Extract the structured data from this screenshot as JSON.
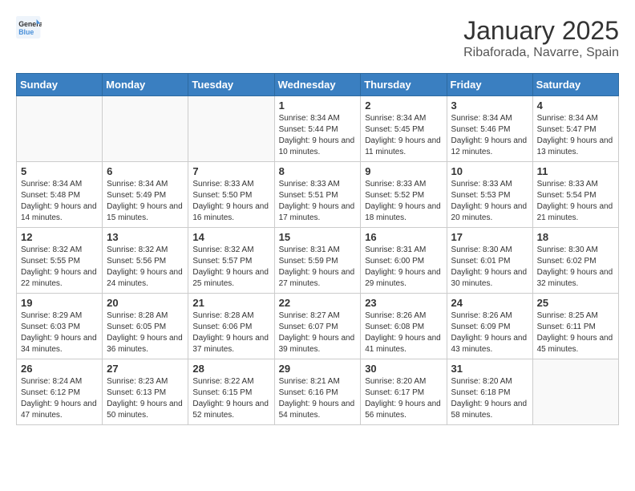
{
  "header": {
    "logo_general": "General",
    "logo_blue": "Blue",
    "title": "January 2025",
    "subtitle": "Ribaforada, Navarre, Spain"
  },
  "weekdays": [
    "Sunday",
    "Monday",
    "Tuesday",
    "Wednesday",
    "Thursday",
    "Friday",
    "Saturday"
  ],
  "weeks": [
    [
      {
        "date": "",
        "sunrise": "",
        "sunset": "",
        "daylight": "",
        "empty": true
      },
      {
        "date": "",
        "sunrise": "",
        "sunset": "",
        "daylight": "",
        "empty": true
      },
      {
        "date": "",
        "sunrise": "",
        "sunset": "",
        "daylight": "",
        "empty": true
      },
      {
        "date": "1",
        "sunrise": "Sunrise: 8:34 AM",
        "sunset": "Sunset: 5:44 PM",
        "daylight": "Daylight: 9 hours and 10 minutes.",
        "empty": false
      },
      {
        "date": "2",
        "sunrise": "Sunrise: 8:34 AM",
        "sunset": "Sunset: 5:45 PM",
        "daylight": "Daylight: 9 hours and 11 minutes.",
        "empty": false
      },
      {
        "date": "3",
        "sunrise": "Sunrise: 8:34 AM",
        "sunset": "Sunset: 5:46 PM",
        "daylight": "Daylight: 9 hours and 12 minutes.",
        "empty": false
      },
      {
        "date": "4",
        "sunrise": "Sunrise: 8:34 AM",
        "sunset": "Sunset: 5:47 PM",
        "daylight": "Daylight: 9 hours and 13 minutes.",
        "empty": false
      }
    ],
    [
      {
        "date": "5",
        "sunrise": "Sunrise: 8:34 AM",
        "sunset": "Sunset: 5:48 PM",
        "daylight": "Daylight: 9 hours and 14 minutes.",
        "empty": false
      },
      {
        "date": "6",
        "sunrise": "Sunrise: 8:34 AM",
        "sunset": "Sunset: 5:49 PM",
        "daylight": "Daylight: 9 hours and 15 minutes.",
        "empty": false
      },
      {
        "date": "7",
        "sunrise": "Sunrise: 8:33 AM",
        "sunset": "Sunset: 5:50 PM",
        "daylight": "Daylight: 9 hours and 16 minutes.",
        "empty": false
      },
      {
        "date": "8",
        "sunrise": "Sunrise: 8:33 AM",
        "sunset": "Sunset: 5:51 PM",
        "daylight": "Daylight: 9 hours and 17 minutes.",
        "empty": false
      },
      {
        "date": "9",
        "sunrise": "Sunrise: 8:33 AM",
        "sunset": "Sunset: 5:52 PM",
        "daylight": "Daylight: 9 hours and 18 minutes.",
        "empty": false
      },
      {
        "date": "10",
        "sunrise": "Sunrise: 8:33 AM",
        "sunset": "Sunset: 5:53 PM",
        "daylight": "Daylight: 9 hours and 20 minutes.",
        "empty": false
      },
      {
        "date": "11",
        "sunrise": "Sunrise: 8:33 AM",
        "sunset": "Sunset: 5:54 PM",
        "daylight": "Daylight: 9 hours and 21 minutes.",
        "empty": false
      }
    ],
    [
      {
        "date": "12",
        "sunrise": "Sunrise: 8:32 AM",
        "sunset": "Sunset: 5:55 PM",
        "daylight": "Daylight: 9 hours and 22 minutes.",
        "empty": false
      },
      {
        "date": "13",
        "sunrise": "Sunrise: 8:32 AM",
        "sunset": "Sunset: 5:56 PM",
        "daylight": "Daylight: 9 hours and 24 minutes.",
        "empty": false
      },
      {
        "date": "14",
        "sunrise": "Sunrise: 8:32 AM",
        "sunset": "Sunset: 5:57 PM",
        "daylight": "Daylight: 9 hours and 25 minutes.",
        "empty": false
      },
      {
        "date": "15",
        "sunrise": "Sunrise: 8:31 AM",
        "sunset": "Sunset: 5:59 PM",
        "daylight": "Daylight: 9 hours and 27 minutes.",
        "empty": false
      },
      {
        "date": "16",
        "sunrise": "Sunrise: 8:31 AM",
        "sunset": "Sunset: 6:00 PM",
        "daylight": "Daylight: 9 hours and 29 minutes.",
        "empty": false
      },
      {
        "date": "17",
        "sunrise": "Sunrise: 8:30 AM",
        "sunset": "Sunset: 6:01 PM",
        "daylight": "Daylight: 9 hours and 30 minutes.",
        "empty": false
      },
      {
        "date": "18",
        "sunrise": "Sunrise: 8:30 AM",
        "sunset": "Sunset: 6:02 PM",
        "daylight": "Daylight: 9 hours and 32 minutes.",
        "empty": false
      }
    ],
    [
      {
        "date": "19",
        "sunrise": "Sunrise: 8:29 AM",
        "sunset": "Sunset: 6:03 PM",
        "daylight": "Daylight: 9 hours and 34 minutes.",
        "empty": false
      },
      {
        "date": "20",
        "sunrise": "Sunrise: 8:28 AM",
        "sunset": "Sunset: 6:05 PM",
        "daylight": "Daylight: 9 hours and 36 minutes.",
        "empty": false
      },
      {
        "date": "21",
        "sunrise": "Sunrise: 8:28 AM",
        "sunset": "Sunset: 6:06 PM",
        "daylight": "Daylight: 9 hours and 37 minutes.",
        "empty": false
      },
      {
        "date": "22",
        "sunrise": "Sunrise: 8:27 AM",
        "sunset": "Sunset: 6:07 PM",
        "daylight": "Daylight: 9 hours and 39 minutes.",
        "empty": false
      },
      {
        "date": "23",
        "sunrise": "Sunrise: 8:26 AM",
        "sunset": "Sunset: 6:08 PM",
        "daylight": "Daylight: 9 hours and 41 minutes.",
        "empty": false
      },
      {
        "date": "24",
        "sunrise": "Sunrise: 8:26 AM",
        "sunset": "Sunset: 6:09 PM",
        "daylight": "Daylight: 9 hours and 43 minutes.",
        "empty": false
      },
      {
        "date": "25",
        "sunrise": "Sunrise: 8:25 AM",
        "sunset": "Sunset: 6:11 PM",
        "daylight": "Daylight: 9 hours and 45 minutes.",
        "empty": false
      }
    ],
    [
      {
        "date": "26",
        "sunrise": "Sunrise: 8:24 AM",
        "sunset": "Sunset: 6:12 PM",
        "daylight": "Daylight: 9 hours and 47 minutes.",
        "empty": false
      },
      {
        "date": "27",
        "sunrise": "Sunrise: 8:23 AM",
        "sunset": "Sunset: 6:13 PM",
        "daylight": "Daylight: 9 hours and 50 minutes.",
        "empty": false
      },
      {
        "date": "28",
        "sunrise": "Sunrise: 8:22 AM",
        "sunset": "Sunset: 6:15 PM",
        "daylight": "Daylight: 9 hours and 52 minutes.",
        "empty": false
      },
      {
        "date": "29",
        "sunrise": "Sunrise: 8:21 AM",
        "sunset": "Sunset: 6:16 PM",
        "daylight": "Daylight: 9 hours and 54 minutes.",
        "empty": false
      },
      {
        "date": "30",
        "sunrise": "Sunrise: 8:20 AM",
        "sunset": "Sunset: 6:17 PM",
        "daylight": "Daylight: 9 hours and 56 minutes.",
        "empty": false
      },
      {
        "date": "31",
        "sunrise": "Sunrise: 8:20 AM",
        "sunset": "Sunset: 6:18 PM",
        "daylight": "Daylight: 9 hours and 58 minutes.",
        "empty": false
      },
      {
        "date": "",
        "sunrise": "",
        "sunset": "",
        "daylight": "",
        "empty": true
      }
    ]
  ]
}
